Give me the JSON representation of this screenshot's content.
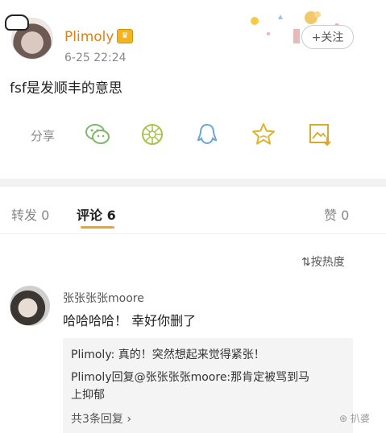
{
  "post": {
    "username": "Plimoly",
    "vip_badge": "👑",
    "time": "6-25 22:24",
    "follow_label": "+关注",
    "text": "fsf是发顺丰的意思",
    "share_label": "分享"
  },
  "share_icons": [
    "wechat-icon",
    "moments-icon",
    "qq-icon",
    "star-icon",
    "save-image-icon"
  ],
  "tabs": {
    "repost": "转发 0",
    "comments": "评论 6",
    "likes": "赞 0"
  },
  "sort_label": "按热度",
  "comment": {
    "name": "张张张张moore",
    "text": "哈哈哈哈！ 幸好你删了",
    "replies": [
      "Plimoly: 真的！突然想起来觉得紧张！",
      "Plimoly回复@张张张张moore:那肯定被骂到马",
      "上抑郁"
    ],
    "more_replies": "共3条回复 ›"
  },
  "watermark": "扒婆",
  "colors": {
    "accent": "#f3a41c",
    "username": "#e07f14",
    "icon_green": "#7eb86a"
  }
}
